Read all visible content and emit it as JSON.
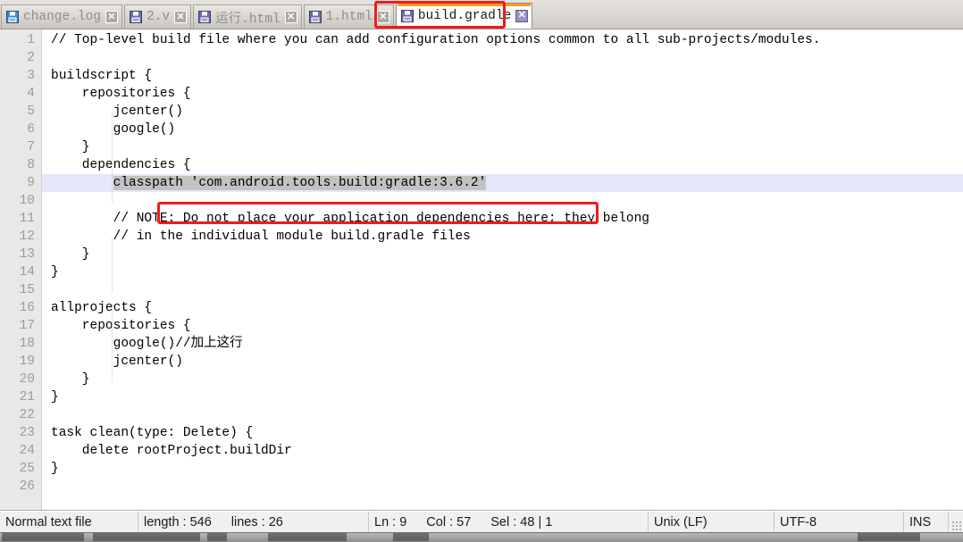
{
  "window": {
    "app": "Notepad++",
    "accent_orange": "#ff9b21",
    "annotation_color": "#ef1b1b",
    "current_line_color": "#e6e6fa",
    "selection_color": "#c2c2c2"
  },
  "tabbar": {
    "tabs": [
      {
        "label": "change.log",
        "icon": "floppy-disk-icon",
        "icon_color": "#3a8ddb",
        "close_label": "✕",
        "active": false
      },
      {
        "label": "2.v",
        "icon": "floppy-disk-icon",
        "icon_color": "#6a6ab0",
        "close_label": "✕",
        "active": false
      },
      {
        "label": "运行.html",
        "icon": "floppy-disk-icon",
        "icon_color": "#6a6ab0",
        "close_label": "✕",
        "active": false
      },
      {
        "label": "1.html",
        "icon": "floppy-disk-icon",
        "icon_color": "#6a6ab0",
        "close_label": "✕",
        "active": false
      },
      {
        "label": "build.gradle",
        "icon": "floppy-disk-icon",
        "icon_color": "#6a6ab0",
        "close_label": "✕",
        "active": true
      }
    ],
    "annotation_target": "build.gradle"
  },
  "editor": {
    "filename": "build.gradle",
    "current_line": 9,
    "annotated_line": 9,
    "selection_text": "classpath 'com.android.tools.build:gradle:3.6.2'",
    "line_numbers": [
      1,
      2,
      3,
      4,
      5,
      6,
      7,
      8,
      9,
      10,
      11,
      12,
      13,
      14,
      15,
      16,
      17,
      18,
      19,
      20,
      21,
      22,
      23,
      24,
      25,
      26
    ],
    "lines": [
      {
        "n": 1,
        "text": "// Top-level build file where you can add configuration options common to all sub-projects/modules."
      },
      {
        "n": 2,
        "text": ""
      },
      {
        "n": 3,
        "text": "buildscript {"
      },
      {
        "n": 4,
        "text": "    repositories {"
      },
      {
        "n": 5,
        "text": "        jcenter()"
      },
      {
        "n": 6,
        "text": "        google()"
      },
      {
        "n": 7,
        "text": "    }"
      },
      {
        "n": 8,
        "text": "    dependencies {"
      },
      {
        "n": 9,
        "text": "        classpath 'com.android.tools.build:gradle:3.6.2'"
      },
      {
        "n": 10,
        "text": ""
      },
      {
        "n": 11,
        "text": "        // NOTE: Do not place your application dependencies here; they belong"
      },
      {
        "n": 12,
        "text": "        // in the individual module build.gradle files"
      },
      {
        "n": 13,
        "text": "    }"
      },
      {
        "n": 14,
        "text": "}"
      },
      {
        "n": 15,
        "text": ""
      },
      {
        "n": 16,
        "text": "allprojects {"
      },
      {
        "n": 17,
        "text": "    repositories {"
      },
      {
        "n": 18,
        "text": "        google()//加上这行"
      },
      {
        "n": 19,
        "text": "        jcenter()"
      },
      {
        "n": 20,
        "text": "    }"
      },
      {
        "n": 21,
        "text": "}"
      },
      {
        "n": 22,
        "text": ""
      },
      {
        "n": 23,
        "text": "task clean(type: Delete) {"
      },
      {
        "n": 24,
        "text": "    delete rootProject.buildDir"
      },
      {
        "n": 25,
        "text": "}"
      },
      {
        "n": 26,
        "text": ""
      }
    ]
  },
  "statusbar": {
    "doc_type": "Normal text file",
    "length_label": "length : 546",
    "lines_label": "lines : 26",
    "ln_label": "Ln : 9",
    "col_label": "Col : 57",
    "sel_label": "Sel : 48 | 1",
    "eol": "Unix (LF)",
    "encoding": "UTF-8",
    "insert_mode": "INS"
  }
}
